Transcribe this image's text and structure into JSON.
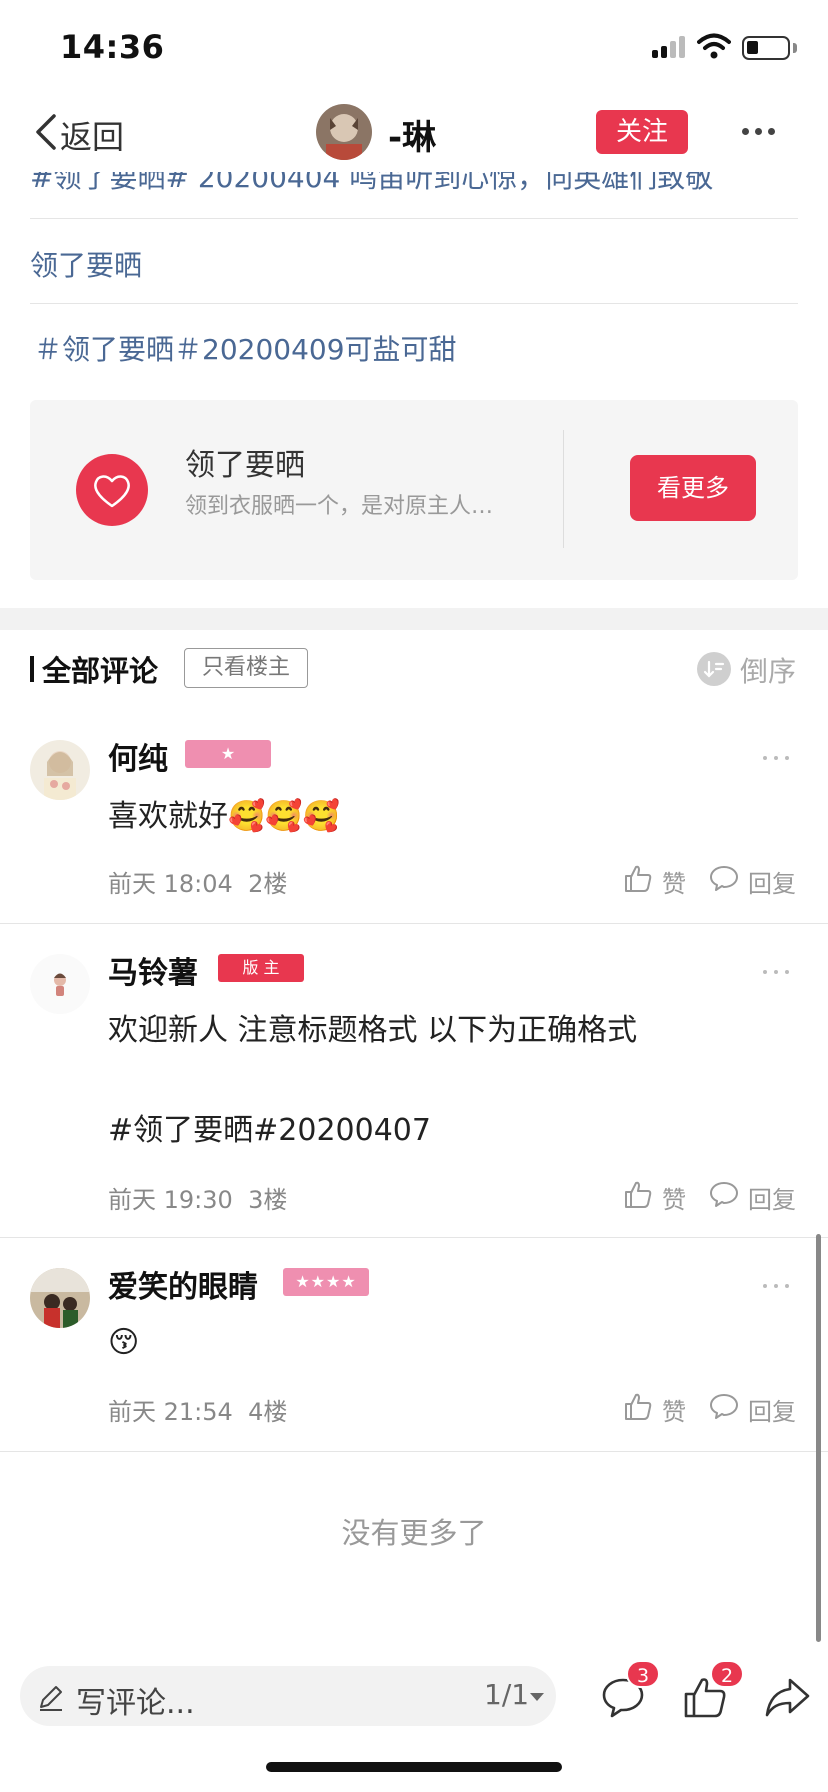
{
  "status_bar": {
    "time": "14:36"
  },
  "nav": {
    "back_label": "返回",
    "username": "-琳",
    "follow_label": "关注"
  },
  "post": {
    "tag_partial": "#领了要晒# 20200404 鸣笛听到心惊，向英雄们致敬",
    "plain_line": "领了要晒",
    "tag_line": "＃领了要晒＃20200409可盐可甜"
  },
  "topic_card": {
    "title": "领了要晒",
    "description": "领到衣服晒一个，是对原主人…",
    "button_label": "看更多"
  },
  "comments_header": {
    "title": "全部评论",
    "owner_only_label": "只看楼主",
    "sort_label": "倒序"
  },
  "comments": [
    {
      "name": "何纯",
      "badge": "★",
      "body": "喜欢就好🥰🥰🥰",
      "time": "前天 18:04",
      "floor": "2楼",
      "like_label": "赞",
      "reply_label": "回复"
    },
    {
      "name": "马铃薯",
      "badge": "版 主",
      "body": "欢迎新人 注意标题格式 以下为正确格式\n\n#领了要晒#20200407",
      "time": "前天 19:30",
      "floor": "3楼",
      "like_label": "赞",
      "reply_label": "回复"
    },
    {
      "name": "爱笑的眼睛",
      "badge": "★★★★",
      "body": "😚",
      "time": "前天 21:54",
      "floor": "4楼",
      "like_label": "赞",
      "reply_label": "回复"
    }
  ],
  "footer": {
    "no_more": "没有更多了"
  },
  "bottom_bar": {
    "input_placeholder": "写评论...",
    "page_indicator": "1/1",
    "comment_count": "3",
    "like_count": "2"
  },
  "colors": {
    "accent": "#e8374f",
    "tag_text": "#4a6894",
    "badge_pink": "#ef8fb0"
  }
}
